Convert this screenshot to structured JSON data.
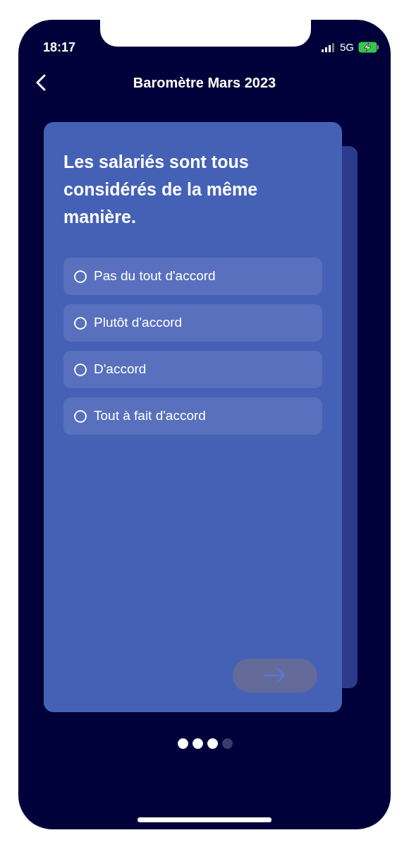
{
  "status_bar": {
    "time": "18:17",
    "network": "5G"
  },
  "header": {
    "title": "Baromètre Mars 2023"
  },
  "question": {
    "text": "Les salariés sont tous considérés de la même manière.",
    "options": [
      {
        "label": "Pas du tout d'accord",
        "selected": false
      },
      {
        "label": "Plutôt d'accord",
        "selected": false
      },
      {
        "label": "D'accord",
        "selected": false
      },
      {
        "label": "Tout à fait d'accord",
        "selected": false
      }
    ]
  },
  "next_button": {
    "disabled": true
  },
  "progress_dots": [
    {
      "filled": true
    },
    {
      "filled": true
    },
    {
      "filled": true
    },
    {
      "filled": false
    }
  ]
}
